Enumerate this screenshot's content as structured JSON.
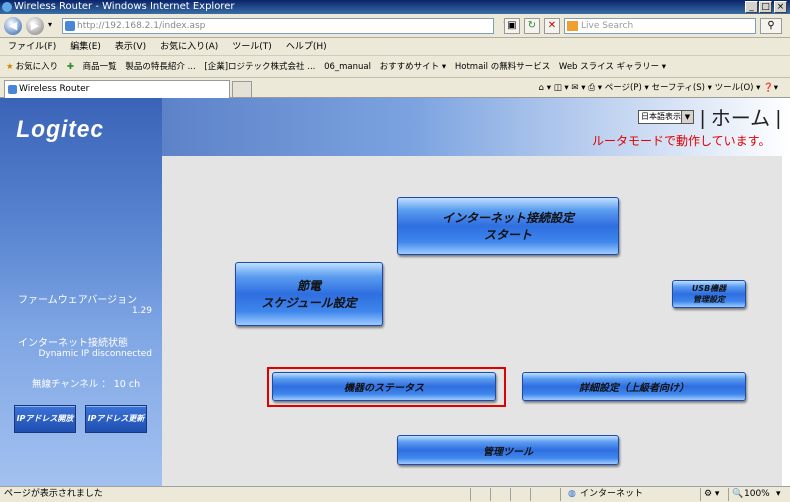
{
  "window": {
    "title": "Wireless Router - Windows Internet Explorer"
  },
  "address": {
    "url": "http://192.168.2.1/index.asp"
  },
  "search": {
    "placeholder": "Live Search"
  },
  "menu": [
    "ファイル(F)",
    "編集(E)",
    "表示(V)",
    "お気に入り(A)",
    "ツール(T)",
    "ヘルプ(H)"
  ],
  "favorites": {
    "label": "お気に入り",
    "items": [
      "商品一覧",
      "製品の特長紹介 ...",
      "[企業]ロジテック株式会社 ...",
      "06_manual",
      "おすすめサイト ▾",
      "Hotmail の無料サービス",
      "Web スライス ギャラリー ▾"
    ]
  },
  "tab": {
    "title": "Wireless Router"
  },
  "command_bar": {
    "page": "ページ(P) ▾",
    "safety": "セーフティ(S) ▾",
    "tools": "ツール(O) ▾"
  },
  "header": {
    "logo": "Logitec",
    "lang_select": "日本語表示",
    "home": "| ホーム |",
    "mode_text": "ルータモードで動作しています。"
  },
  "sidebar": {
    "firmware_label": "ファームウェアバージョン",
    "firmware_value": "1.29",
    "conn_label": "インターネット接続状態",
    "conn_value": "Dynamic IP disconnected",
    "channel_text": "無線チャンネル ： 10 ch",
    "release_button": "IPアドレス開放",
    "renew_button": "IPアドレス更新"
  },
  "buttons": {
    "internet_setup": [
      "インターネット接続設定",
      "スタート"
    ],
    "schedule": [
      "節電",
      "スケジュール設定"
    ],
    "usb": [
      "USB機器",
      "管理設定"
    ],
    "status": "機器のステータス",
    "advanced": "詳細設定（上級者向け）",
    "admin": "管理ツール"
  },
  "status_bar": {
    "text": "ページが表示されました",
    "zone": "インターネット",
    "zoom": "100%"
  },
  "colors": {
    "sidebar_top": "#3a63b7",
    "mode_text": "#e00000",
    "highlight": "#e00000"
  }
}
